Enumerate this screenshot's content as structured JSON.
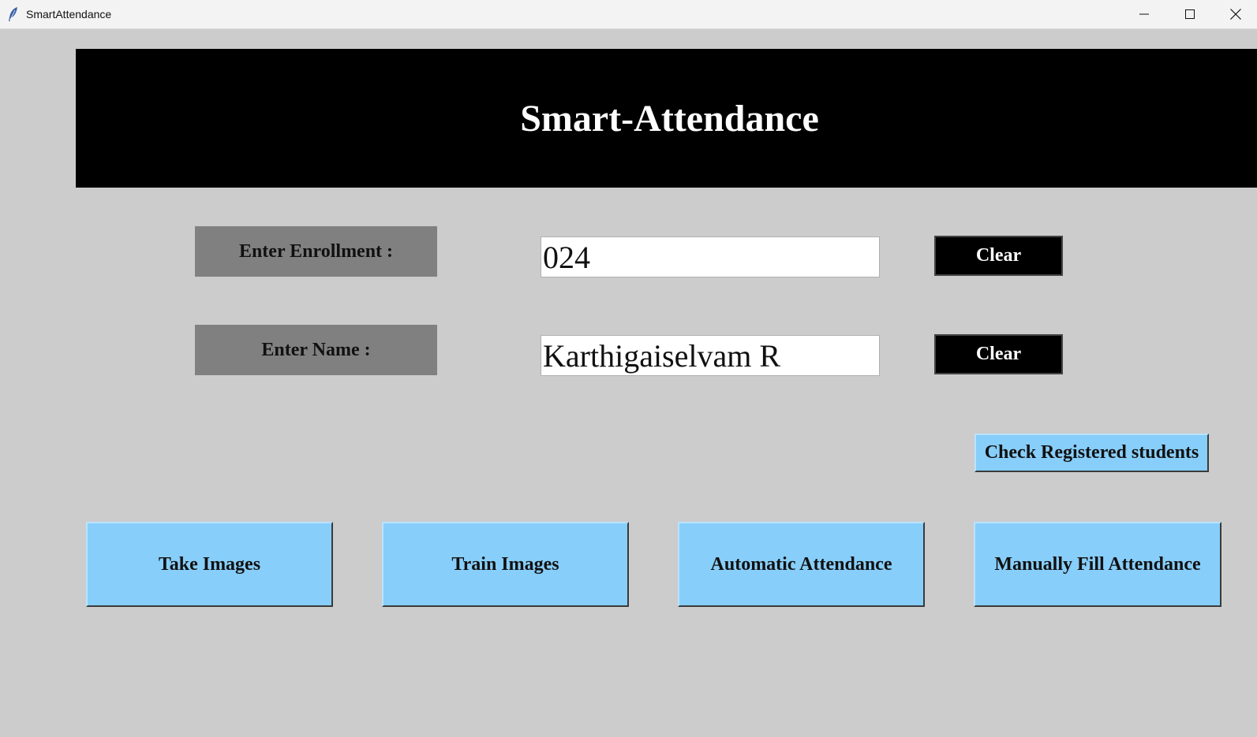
{
  "window": {
    "title": "SmartAttendance",
    "icon": "feather-icon",
    "controls": [
      "minimize-icon",
      "maximize-icon",
      "close-icon"
    ]
  },
  "banner": {
    "heading": "Smart-Attendance"
  },
  "form": {
    "enrollment_label": "Enter Enrollment :",
    "enrollment_value": "024",
    "name_label": "Enter Name :",
    "name_value": "Karthigaiselvam R",
    "clear_label": "Clear"
  },
  "actions": {
    "check_registered": "Check Registered students",
    "take_images": "Take Images",
    "train_images": "Train Images",
    "automatic_attendance": "Automatic Attendance",
    "manual_attendance": "Manually Fill Attendance"
  },
  "colors": {
    "background": "#cccccc",
    "banner": "#000000",
    "label_bg": "#808080",
    "button_blue": "#87cefa",
    "clear_bg": "#000000"
  }
}
